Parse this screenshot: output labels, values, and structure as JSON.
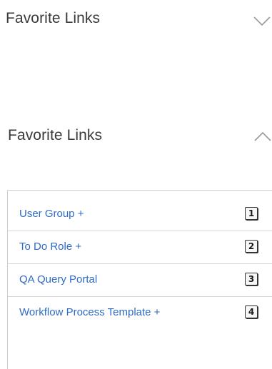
{
  "collapsed_panel": {
    "title": "Favorite Links",
    "chevron_icon": "chevron-down-icon"
  },
  "expanded_panel": {
    "title": "Favorite Links",
    "chevron_icon": "chevron-up-icon",
    "links": [
      {
        "label": "User Group +",
        "shortcut": "1"
      },
      {
        "label": "To Do Role +",
        "shortcut": "2"
      },
      {
        "label": "QA Query Portal",
        "shortcut": "3"
      },
      {
        "label": "Workflow Process Template +",
        "shortcut": "4"
      }
    ]
  },
  "colors": {
    "link": "#2e6bc2",
    "title": "#3a3a3a",
    "border": "#cfcfcf",
    "chevron": "#9a9a9a"
  }
}
